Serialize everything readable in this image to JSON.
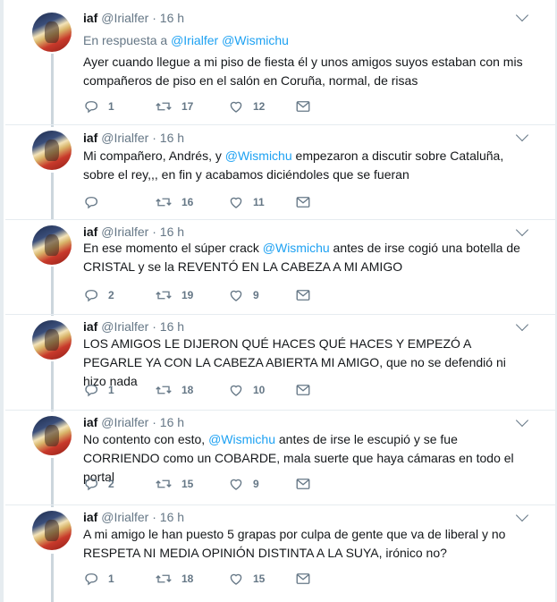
{
  "tweets": [
    {
      "name": "iaf",
      "handle": "@Irialfer",
      "time": "16 h",
      "reply_prefix": "En respuesta a",
      "reply_user1": "@Irialfer",
      "reply_user2": "@Wismichu",
      "text_a": "Ayer cuando llegue a mi piso de fiesta él y unos amigos suyos estaban con mis compañeros de piso en el salón en Coruña, normal, de risas",
      "replies": "1",
      "retweets": "17",
      "likes": "12"
    },
    {
      "name": "iaf",
      "handle": "@Irialfer",
      "time": "16 h",
      "text_a": "Mi compañero, Andrés, y ",
      "mention": "@Wismichu",
      "text_b": " empezaron a discutir sobre Cataluña, sobre el rey,,, en fin y acabamos diciéndoles que se fueran",
      "replies": "",
      "retweets": "16",
      "likes": "11"
    },
    {
      "name": "iaf",
      "handle": "@Irialfer",
      "time": "16 h",
      "text_a": "En ese momento el súper crack ",
      "mention": "@Wismichu",
      "text_b": " antes de irse cogió una botella de CRISTAL y se la REVENTÓ EN LA CABEZA A MI AMIGO",
      "replies": "2",
      "retweets": "19",
      "likes": "9"
    },
    {
      "name": "iaf",
      "handle": "@Irialfer",
      "time": "16 h",
      "text_a": "LOS AMIGOS LE DIJERON QUÉ HACES QUÉ HACES Y EMPEZÓ A PEGARLE YA CON LA CABEZA ABIERTA MI AMIGO, que no se defendió ni hizo nada",
      "replies": "1",
      "retweets": "18",
      "likes": "10"
    },
    {
      "name": "iaf",
      "handle": "@Irialfer",
      "time": "16 h",
      "text_a": "No contento con esto, ",
      "mention": "@Wismichu",
      "text_b": " antes de irse le escupió y se fue CORRIENDO como un COBARDE, mala suerte que haya cámaras en todo el portal",
      "replies": "2",
      "retweets": "15",
      "likes": "9"
    },
    {
      "name": "iaf",
      "handle": "@Irialfer",
      "time": "16 h",
      "text_a": "A mi amigo le han puesto 5 grapas por culpa de gente que va de liberal y no RESPETA NI MEDIA OPINIÓN DISTINTA A LA SUYA, irónico no?",
      "replies": "1",
      "retweets": "18",
      "likes": "15"
    }
  ],
  "colors": {
    "text": "#14171a",
    "muted": "#657786",
    "link": "#1da1f2",
    "divider": "#e6ecf0",
    "thread": "#ccd6dd"
  },
  "icons": {
    "reply": "reply-icon",
    "retweet": "retweet-icon",
    "like": "heart-icon",
    "dm": "envelope-icon",
    "menu": "chevron-down-icon"
  }
}
